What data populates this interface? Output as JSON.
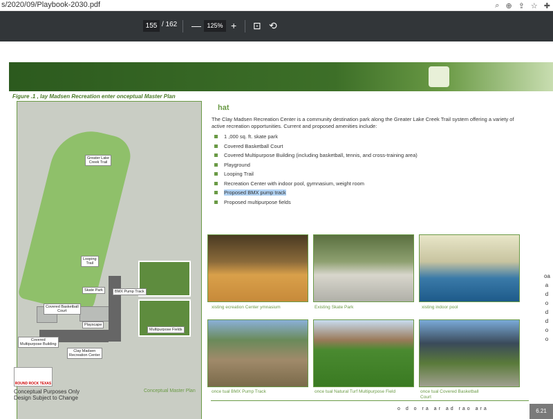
{
  "browser": {
    "url": "s/2020/09/Playbook-2030.pdf",
    "icons": [
      "search-icon",
      "zoom-icon",
      "share-icon",
      "star-icon",
      "puzzle-icon"
    ]
  },
  "toolbar": {
    "page_current": "155",
    "page_total": "/ 162",
    "zoom_out": "—",
    "zoom": "125%",
    "zoom_in": "+",
    "fit_icon": "⊡",
    "rotate_icon": "⟲"
  },
  "document": {
    "figure_caption": "Figure  .1 ,  lay Madsen Recreation   enter   onceptual Master Plan",
    "section_heading": "hat",
    "intro": "The Clay Madsen Recreation Center is a community destination park along the Greater Lake Creek Trail system offering a variety of active recreation opportunities.  Current and proposed amenities include:",
    "amenities": [
      "1  ,000 sq. ft. skate park",
      "Covered Basketball Court",
      "Covered Multipurpose Building (including basketball, tennis, and cross-training area)",
      "Playground",
      "Looping Trail",
      "Recreation Center with indoor pool, gymnasium, weight room",
      "Proposed BMX pump track",
      "Proposed multipurpose fields"
    ],
    "map_labels": {
      "greater_lake": "Greater Lake\nCreek Trail",
      "looping": "Looping\nTrail",
      "skate": "Skate Park",
      "bmx": "BMX Pump Track",
      "basketball": "Covered Basketball\nCourt",
      "playscape": "Playscape",
      "multipurpose_fields": "Multipurpose Fields",
      "covered_bldg": "Covered\nMultipurpose Building",
      "rec_center": "Clay Madsen\nRecreation Center"
    },
    "logo_text": "ROUND ROCK TEXAS",
    "map_note_1": "Conceptual Purposes Only",
    "map_note_2": "Design Subject to Change",
    "map_caption": "Conceptual Master Plan",
    "photo_captions": [
      "xisting   ecreation Center   ymnasium",
      "Existing Skate Park",
      "xisting indoor pool",
      "once  tual BMX Pump Track",
      "once  tual Natural Turf Multipurpose Field",
      "once  tual Covered Basketball\nCourt"
    ],
    "side_text": "oa a d o   d d o  o",
    "footer_text": "o d o  ra    ar ad  rao  ara",
    "page_number": "6.21"
  },
  "colors": {
    "accent": "#6a9a45",
    "toolbar": "#323639",
    "highlight": "#b3d4f5"
  }
}
